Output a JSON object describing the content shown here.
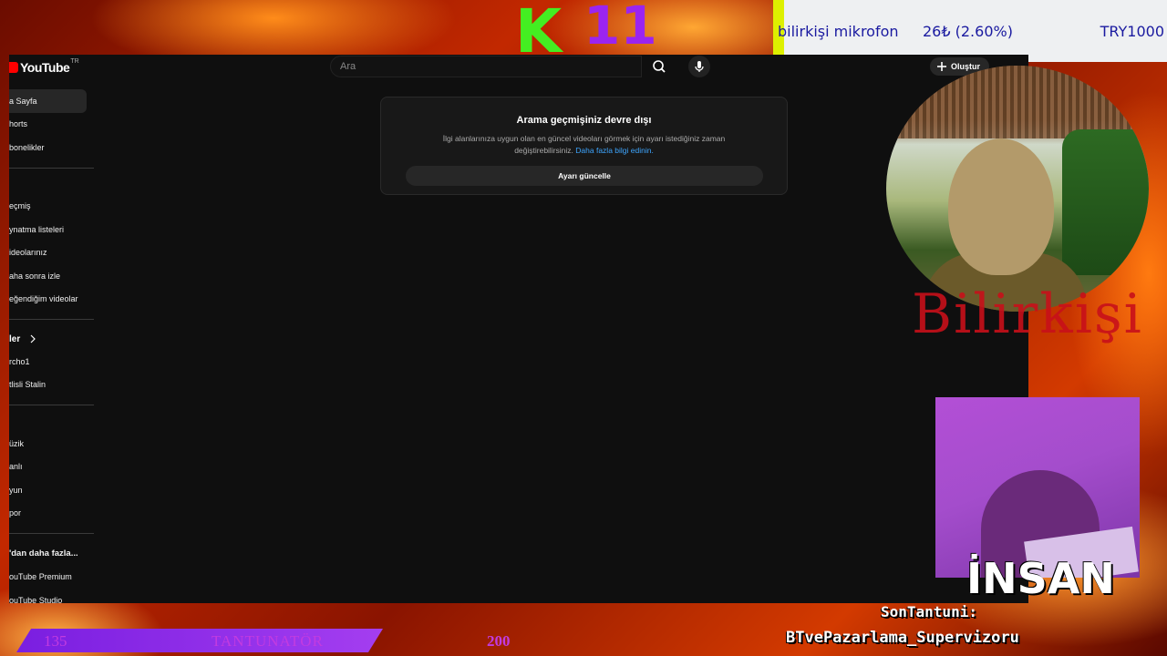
{
  "overlay": {
    "counter_letter": "K",
    "counter_number": "11",
    "ticker": {
      "item": "bilirkişi mikrofon",
      "price": "26₺ (2.60%)",
      "goal": "TRY1000"
    },
    "webcam_label": "Bilirkişi",
    "guest_label": "İNSAN",
    "last_tantuni_label": "SonTantuni:",
    "last_tantuni_name": "BTvePazarlama_Supervizoru",
    "progress": {
      "current": "135",
      "label": "TANTUNATÖR",
      "goal": "200"
    },
    "colors": {
      "green": "#44ee22",
      "purple": "#9b24f0",
      "ticker_text": "#1a1aa0",
      "ticker_accent": "#ddf000"
    }
  },
  "youtube": {
    "logo": "YouTube",
    "region": "TR",
    "search": {
      "placeholder": "Ara"
    },
    "create_label": "Oluştur",
    "sidebar": {
      "group1": [
        "a Sayfa",
        "horts",
        "bonelikler"
      ],
      "group2": [
        "eçmiş",
        "ynatma listeleri",
        "ideolarınız",
        "aha sonra izle",
        "eğendiğim videolar"
      ],
      "subs_header": "ler",
      "subs": [
        "rcho1",
        "tlisli Stalin"
      ],
      "explore": [
        "üzik",
        "anlı",
        "yun",
        "por"
      ],
      "more_header": "'dan daha fazla...",
      "more": [
        "ouTube Premium",
        "ouTube Studio"
      ]
    },
    "notice": {
      "title": "Arama geçmişiniz devre dışı",
      "text": "İlgi alanlarınıza uygun olan en güncel videoları görmek için ayarı istediğiniz zaman değiştirebilirsiniz.",
      "link": "Daha fazla bilgi edinin.",
      "button": "Ayarı güncelle"
    }
  }
}
